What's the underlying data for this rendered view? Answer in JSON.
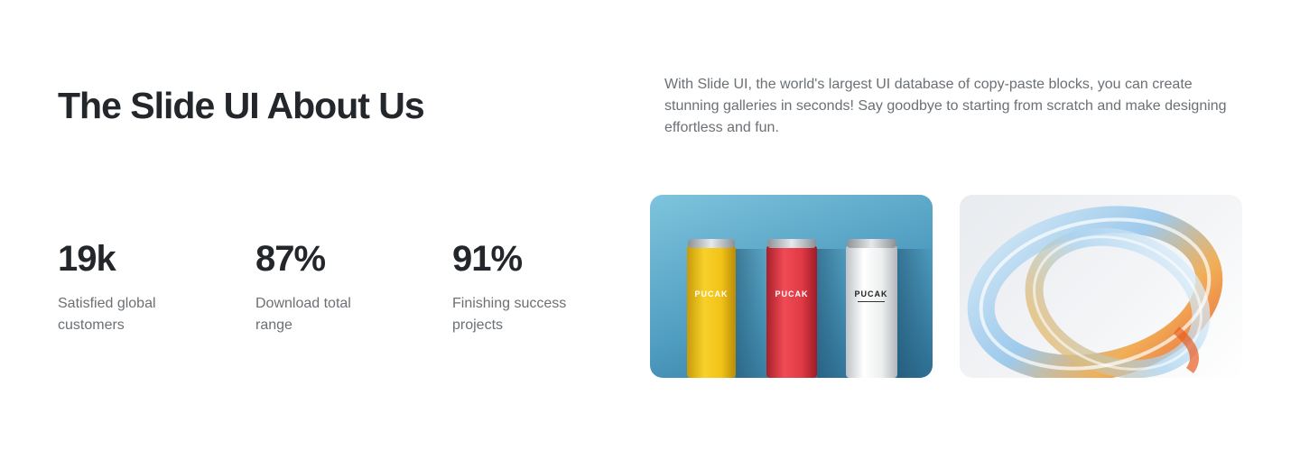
{
  "section": {
    "title": "The Slide UI About Us",
    "description": "With Slide UI, the world's largest UI database of copy-paste blocks, you can create stunning galleries in seconds! Say goodbye to starting from scratch and make designing effortless and fun."
  },
  "stats": [
    {
      "value": "19k",
      "label_line1": "Satisfied global",
      "label_line2": "customers"
    },
    {
      "value": "87%",
      "label_line1": "Download total",
      "label_line2": "range"
    },
    {
      "value": "91%",
      "label_line1": "Finishing success",
      "label_line2": "projects"
    }
  ],
  "gallery": {
    "cans": {
      "brand_text": "PUCAK",
      "colors": [
        "#f2c318",
        "#e03a45",
        "#ececec"
      ]
    },
    "ring_colors": {
      "light": "#cde6f6",
      "blue": "#8fc3ea",
      "orange": "#f0a23a",
      "deep": "#e85b1f"
    }
  }
}
